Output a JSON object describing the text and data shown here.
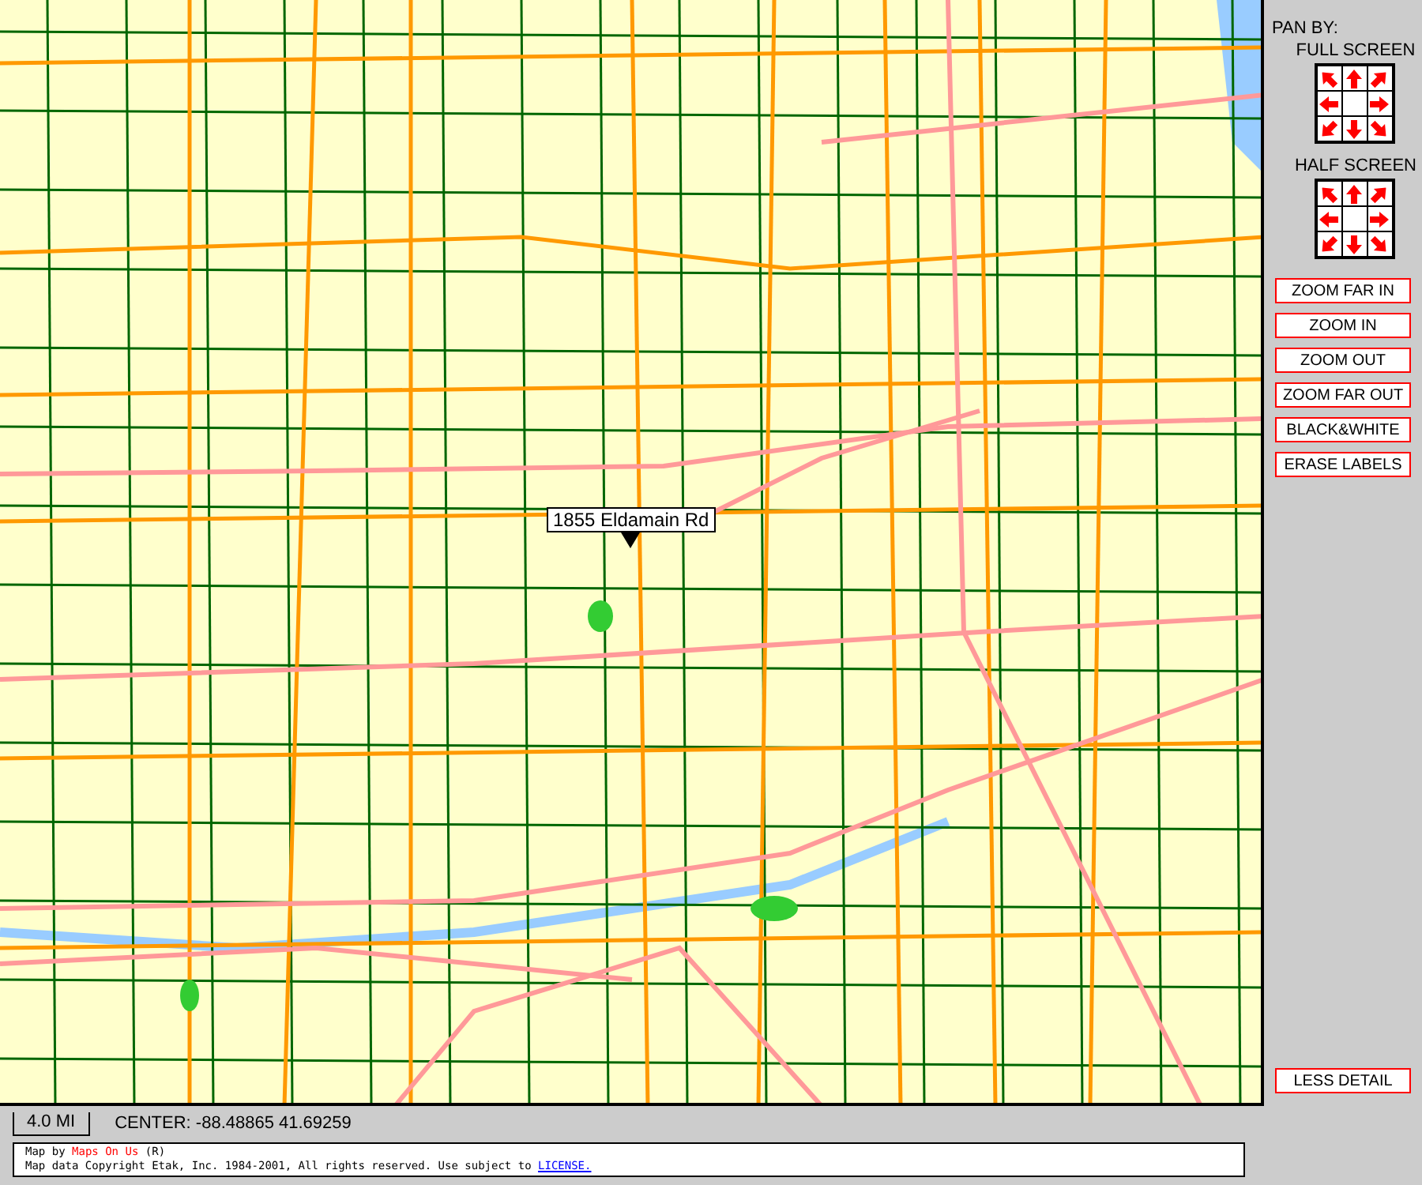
{
  "map": {
    "marker": {
      "label": "1855 Eldamain Rd"
    }
  },
  "sidebar": {
    "title": "PAN BY:",
    "pan_groups": [
      {
        "label": "FULL SCREEN"
      },
      {
        "label": "HALF SCREEN"
      }
    ],
    "button_groups": [
      [
        "ZOOM FAR IN",
        "ZOOM IN"
      ],
      [
        "ZOOM OUT",
        "ZOOM FAR OUT"
      ],
      [
        "BLACK&WHITE",
        "ERASE LABELS"
      ]
    ],
    "detail_button": "LESS DETAIL"
  },
  "status": {
    "scale": "4.0 MI",
    "center": "CENTER: -88.48865 41.69259"
  },
  "footer": {
    "credit_prefix": "Map by",
    "credit_link": "Maps On Us",
    "credit_suffix": "(R)",
    "copyright": "Map data Copyright Etak, Inc. 1984-2001, All rights reserved. Use subject to",
    "license_link": "LICENSE."
  }
}
